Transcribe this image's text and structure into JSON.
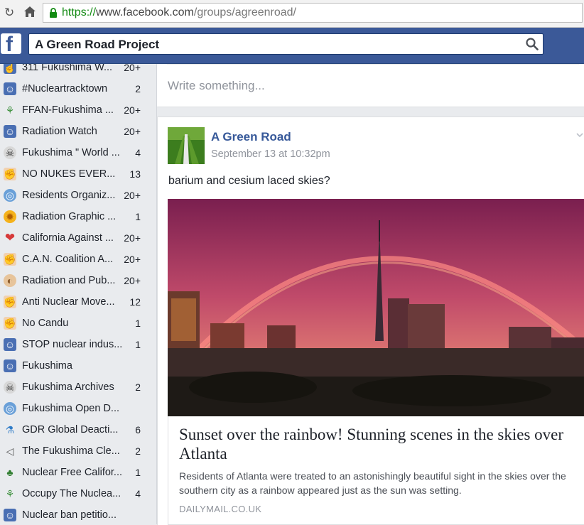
{
  "browser": {
    "url_scheme": "https://",
    "url_host": "www.facebook.com",
    "url_path": "/groups/agreenroad/"
  },
  "header": {
    "search_value": "A Green Road Project"
  },
  "sidebar": {
    "groups": [
      {
        "name": "311 Fukushima W...",
        "count": "20+",
        "icon": "thumb-icon"
      },
      {
        "name": "#Nucleartracktown",
        "count": "2",
        "icon": "group-icon"
      },
      {
        "name": "FFAN-Fukushima ...",
        "count": "20+",
        "icon": "plant-icon"
      },
      {
        "name": "Radiation Watch",
        "count": "20+",
        "icon": "group-icon"
      },
      {
        "name": "Fukushima \" World ...",
        "count": "4",
        "icon": "skull-icon"
      },
      {
        "name": "NO NUKES EVER...",
        "count": "13",
        "icon": "fist-icon"
      },
      {
        "name": "Residents Organiz...",
        "count": "20+",
        "icon": "globe-icon"
      },
      {
        "name": "Radiation Graphic ...",
        "count": "1",
        "icon": "sun-icon"
      },
      {
        "name": "California Against ...",
        "count": "20+",
        "icon": "heart-icon"
      },
      {
        "name": "C.A.N. Coalition A...",
        "count": "20+",
        "icon": "fist-icon"
      },
      {
        "name": "Radiation and Pub...",
        "count": "20+",
        "icon": "planet-icon"
      },
      {
        "name": "Anti Nuclear Move...",
        "count": "12",
        "icon": "fist-icon"
      },
      {
        "name": "No Candu",
        "count": "1",
        "icon": "fist-icon"
      },
      {
        "name": "STOP nuclear indus...",
        "count": "1",
        "icon": "group-icon"
      },
      {
        "name": "Fukushima",
        "count": "",
        "icon": "group-icon"
      },
      {
        "name": "Fukushima Archives",
        "count": "2",
        "icon": "skull-icon"
      },
      {
        "name": "Fukushima Open D...",
        "count": "",
        "icon": "globe-icon"
      },
      {
        "name": "GDR Global Deacti...",
        "count": "6",
        "icon": "flask-icon"
      },
      {
        "name": "The Fukushima Cle...",
        "count": "2",
        "icon": "megaphone-icon"
      },
      {
        "name": "Nuclear Free Califor...",
        "count": "1",
        "icon": "tree-icon"
      },
      {
        "name": "Occupy The Nuclea...",
        "count": "4",
        "icon": "plant-icon"
      },
      {
        "name": "Nuclear ban petitio...",
        "count": "",
        "icon": "group-icon"
      }
    ]
  },
  "composer": {
    "placeholder": "Write something..."
  },
  "post": {
    "author": "A Green Road",
    "timestamp": "September 13 at 10:32pm",
    "text": "barium and cesium laced skies?",
    "link": {
      "title": "Sunset over the rainbow! Stunning scenes in the skies over Atlanta",
      "description": "Residents of Atlanta were treated to an astonishingly beautiful sight in the skies over the southern city as a rainbow appeared just as the sun was setting.",
      "source": "DAILYMAIL.CO.UK"
    }
  },
  "colors": {
    "facebook_blue": "#3b5998",
    "link_blue": "#365899",
    "secure_green": "#128a12"
  }
}
